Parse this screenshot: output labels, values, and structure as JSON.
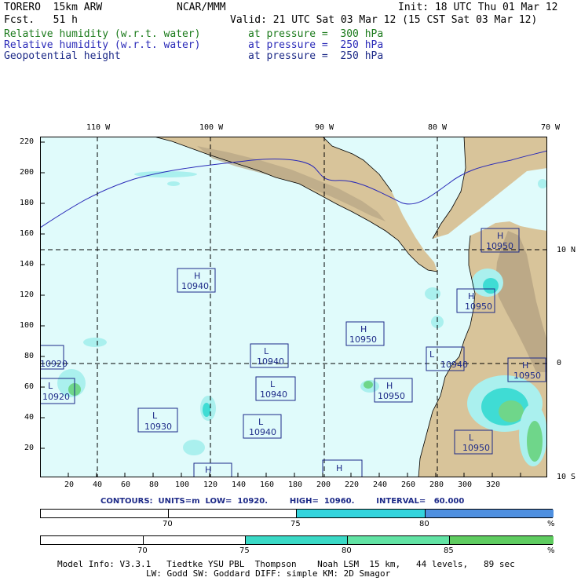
{
  "header": {
    "model": "TORERO  15km ARW",
    "org": "NCAR/MMM",
    "init": "Init: 18 UTC Thu 01 Mar 12",
    "fcst": "Fcst.   51 h",
    "valid": "Valid: 21 UTC Sat 03 Mar 12 (15 CST Sat 03 Mar 12)",
    "fields": [
      {
        "name": "Relative humidity (w.r.t. water)",
        "level": "at pressure =  300 hPa",
        "color": "#1a7a1a"
      },
      {
        "name": "Relative humidity (w.r.t. water)",
        "level": "at pressure =  250 hPa",
        "color": "#2a2ab8"
      },
      {
        "name": "Geopotential height",
        "level": "at pressure =  250 hPa",
        "color": "#1d2a88"
      }
    ]
  },
  "axes": {
    "top_lon": [
      "110 W",
      "100 W",
      "90 W",
      "80 W",
      "70 W"
    ],
    "right_lat": [
      "10 N",
      "0",
      "10 S"
    ],
    "left_y": [
      "220",
      "200",
      "180",
      "160",
      "140",
      "120",
      "100",
      "80",
      "60",
      "40",
      "20"
    ],
    "bottom_x": [
      "20",
      "40",
      "60",
      "80",
      "100",
      "120",
      "140",
      "160",
      "180",
      "200",
      "220",
      "240",
      "260",
      "280",
      "300",
      "320"
    ]
  },
  "map_colors": {
    "ocean": "#e0fbfb",
    "land": "#d8c49a",
    "mountain": "#b7a584",
    "rh_light": "#aaf0ee",
    "rh_mid": "#3fdcd4",
    "rh_green": "#6fd68a"
  },
  "centers": [
    {
      "type": "H",
      "value": "10940"
    },
    {
      "type": "H",
      "value": "10950"
    },
    {
      "type": "H",
      "value": "10950"
    },
    {
      "type": "H",
      "value": "10950"
    },
    {
      "type": "H",
      "value": "10950"
    },
    {
      "type": "H",
      "value": "10950"
    },
    {
      "type": "L",
      "value": "10940"
    },
    {
      "type": "L",
      "value": "10940"
    },
    {
      "type": "L",
      "value": "10940"
    },
    {
      "type": "L",
      "value": "10920"
    },
    {
      "type": "L",
      "value": "10930"
    },
    {
      "type": "L",
      "value": "10940"
    },
    {
      "type": "L",
      "value": "10950"
    },
    {
      "type": "L",
      "value": "10920"
    },
    {
      "type": "H",
      "value": ""
    },
    {
      "type": "H",
      "value": ""
    }
  ],
  "contours_text": "CONTOURS:  UNITS=m  LOW=  10920.        HIGH=  10960.        INTERVAL=   60.000",
  "colorbar1": {
    "labels": [
      "70",
      "75",
      "80",
      "%"
    ],
    "colors": [
      "#ffffff",
      "#33d4dd",
      "#4f90e0"
    ]
  },
  "colorbar2": {
    "labels": [
      "70",
      "75",
      "80",
      "85",
      "%"
    ],
    "colors": [
      "#ffffff",
      "#3ad9c6",
      "#62e3a4",
      "#5fcc60"
    ]
  },
  "footer": {
    "line1": "Model Info: V3.3.1   Tiedtke YSU PBL  Thompson    Noah LSM  15 km,   44 levels,   89 sec",
    "line2": "LW: Godd SW: Goddard DIFF: simple KM: 2D Smagor"
  }
}
